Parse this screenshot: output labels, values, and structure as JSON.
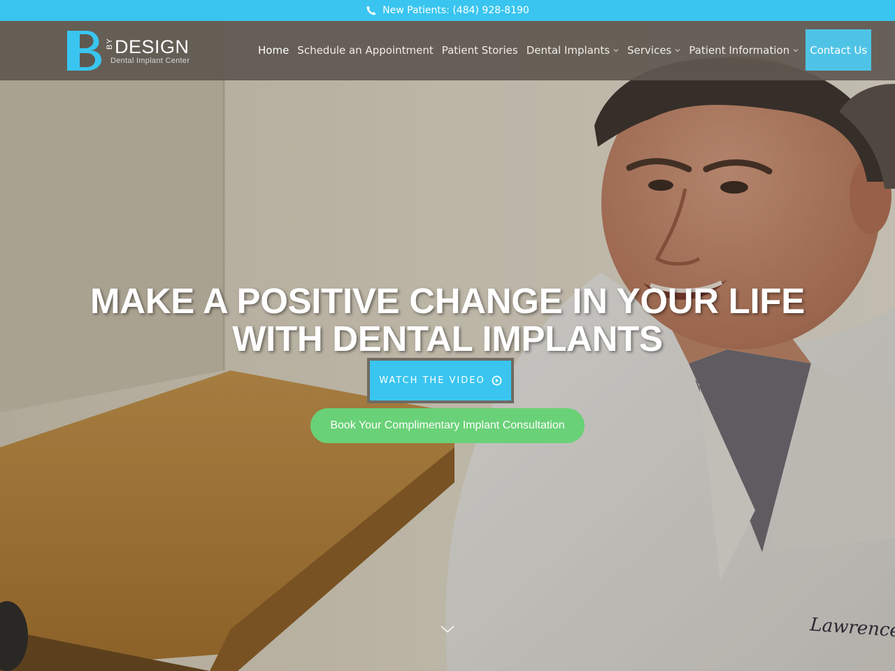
{
  "topbar": {
    "icon": "phone-icon",
    "phone_text": "New Patients: (484) 928-8190"
  },
  "logo": {
    "letter": "B",
    "by": "BY",
    "name": "DESIGN",
    "subtitle": "Dental Implant Center"
  },
  "nav": {
    "items": [
      {
        "label": "Home",
        "active": true,
        "dropdown": false
      },
      {
        "label": "Schedule an Appointment",
        "dropdown": false
      },
      {
        "label": "Patient Stories",
        "dropdown": false
      },
      {
        "label": "Dental Implants",
        "dropdown": true
      },
      {
        "label": "Services",
        "dropdown": true
      },
      {
        "label": "Patient Information",
        "dropdown": true
      },
      {
        "label": "Contact Us",
        "dropdown": false,
        "highlight": true
      }
    ]
  },
  "hero": {
    "headline_line1": "MAKE A POSITIVE CHANGE IN YOUR LIFE",
    "headline_line2": "WITH DENTAL IMPLANTS",
    "watch_label": "WATCH THE VIDEO",
    "book_label": "Book Your Complimentary Implant Consultation",
    "coat_embroidery": "Lawrence N. Le"
  },
  "colors": {
    "accent_blue": "#39c5ef",
    "cta_green": "#69d177",
    "header_bg": "#5f5850"
  }
}
